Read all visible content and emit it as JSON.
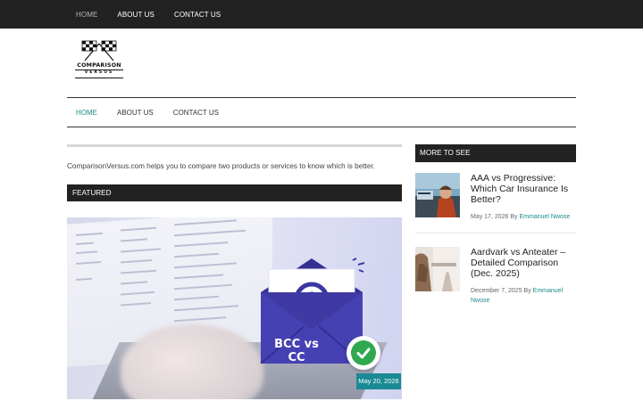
{
  "top_nav": {
    "items": [
      {
        "label": "HOME",
        "active": true
      },
      {
        "label": "ABOUT US",
        "active": false
      },
      {
        "label": "CONTACT US",
        "active": false
      }
    ]
  },
  "logo": {
    "line1": "COMPARISON",
    "line2": "VERSUS",
    "icon": "crossed-checkered-flags-icon"
  },
  "main_nav": {
    "items": [
      {
        "label": "HOME",
        "active": true
      },
      {
        "label": "ABOUT US",
        "active": false
      },
      {
        "label": "CONTACT US",
        "active": false
      }
    ]
  },
  "intro_text": "ComparisonVersus.com helps you to compare two products or services to know which is better.",
  "featured": {
    "heading": "FEATURED",
    "image_text": "BCC vs CC",
    "date": "May 20, 2026"
  },
  "sidebar": {
    "heading": "MORE TO SEE",
    "posts": [
      {
        "title": "AAA vs Progressive: Which Car Insurance Is Better?",
        "date": "May 17, 2026",
        "by": "By",
        "author": "Emmanuel Nwose"
      },
      {
        "title": "Aardvark vs Anteater – Detailed Comparison (Dec. 2025)",
        "date": "December 7, 2025",
        "by": "By",
        "author": "Emmanuel Nwose"
      }
    ]
  },
  "colors": {
    "topbar": "#222222",
    "accent": "#1a8a8a",
    "date_badge": "#1b8a94",
    "check_green": "#2fa84f",
    "envelope_blue": "#3f3aa3"
  }
}
